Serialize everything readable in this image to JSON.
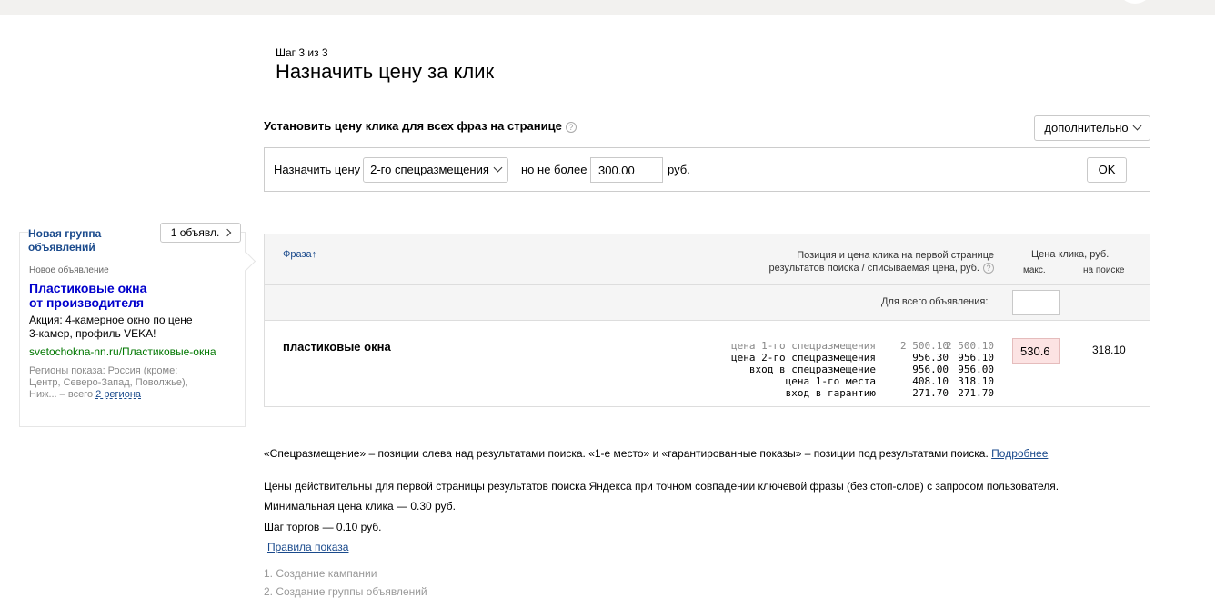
{
  "header": {
    "step": "Шаг 3 из 3",
    "title": "Назначить цену за клик"
  },
  "set_all": {
    "title": "Установить цену клика для всех фраз на странице",
    "help": "?",
    "extra_button": "дополнительно",
    "assign_label": "Назначить цену",
    "position_select": "2-го спецразмещения",
    "no_more_label": "но не более",
    "price_value": "300.00",
    "currency": "руб.",
    "ok_button": "OK"
  },
  "table": {
    "col_phrase": "Фраза",
    "sort_arrow": "↑",
    "col_position_line1": "Позиция и цена клика на первой странице",
    "col_position_line2": "результатов поиска / списываемая цена, руб.",
    "col_price": "Цена клика, руб.",
    "col_max": "макс.",
    "col_search": "на поиске",
    "for_all_label": "Для всего объявления:",
    "for_all_value": "",
    "rows": [
      {
        "phrase": "пластиковые окна",
        "positions": [
          {
            "name": "цена 1-го спецразмещения",
            "price": "2 500.10",
            "charged": "2 500.10"
          },
          {
            "name": "цена 2-го спецразмещения",
            "price": "956.30",
            "charged": "956.10"
          },
          {
            "name": "вход в спецразмещение",
            "price": "956.00",
            "charged": "956.00"
          },
          {
            "name": "цена 1-го места",
            "price": "408.10",
            "charged": "318.10"
          },
          {
            "name": "вход в гарантию",
            "price": "271.70",
            "charged": "271.70"
          }
        ],
        "max_price": "530.6",
        "search_price": "318.10"
      }
    ]
  },
  "ad_card": {
    "group_name": "Новая группа объявлений",
    "ads_button": "1 объявл.",
    "ad_label": "Новое объявление",
    "ad_title_line1": "Пластиковые окна",
    "ad_title_line2": "от производителя",
    "ad_text_line1": "Акция: 4-камерное окно по цене",
    "ad_text_line2": "3-камер, профиль VEKA!",
    "ad_url": "svetochokna-nn.ru/Пластиковые-окна",
    "regions_line1": "Регионы показа: Россия (кроме:",
    "regions_line2": "Центр, Северо-Запад, Поволжье),",
    "regions_line3_prefix": "Ниж... – всего",
    "regions_link": "2 региона"
  },
  "notes": {
    "p1": "«Спецразмещение» – позиции слева над результатами поиска. «1-е место» и «гарантированные показы» – позиции под результатами поиска.",
    "p1_link": "Подробнее",
    "p2": "Цены действительны для первой страницы результатов поиска Яндекса при точном совпадении ключевой фразы (без стоп-слов) с запросом пользователя.",
    "p3": "Минимальная цена клика — 0.30 руб.",
    "p4": "Шаг торгов — 0.10 руб.",
    "rules_link": "Правила показа"
  },
  "steps": {
    "s1": "1. Создание кампании",
    "s2": "2. Создание группы объявлений"
  },
  "colors": {
    "link": "#1a4a8c",
    "ad_title": "#0000cc",
    "ad_url": "#007700",
    "max_price_bg": "#fce3e3",
    "header_bg": "#f5f5f5"
  }
}
